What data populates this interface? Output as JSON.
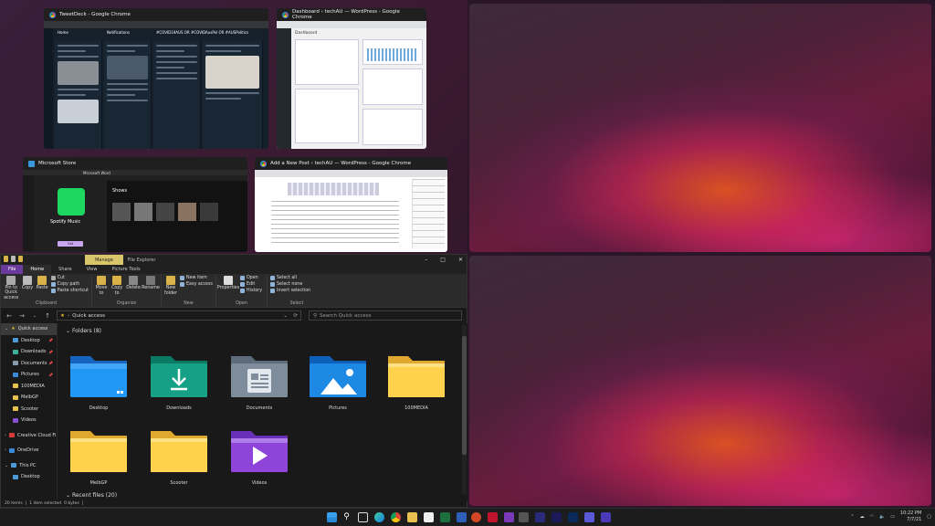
{
  "thumbnails": {
    "tweetdeck": {
      "title": "TweetDeck - Google Chrome",
      "columns": [
        "Home",
        "Notifications",
        "#COVID19AUS OR #COVID",
        "AusPol OR #AUSPolitics"
      ]
    },
    "dashboard": {
      "title": "Dashboard ‹ techAU — WordPress - Google Chrome",
      "heading": "Dashboard"
    },
    "store": {
      "title": "Microsoft Store",
      "tab2": "Microsoft Word",
      "app_name": "Spotify Music",
      "get_label": "Get",
      "shows_label": "Shows"
    },
    "newpost": {
      "title": "Add a New Post ‹ techAU — WordPress - Google Chrome"
    }
  },
  "explorer": {
    "title": "File Explorer",
    "manage_tab": "Manage",
    "window_controls": [
      "–",
      "□",
      "✕"
    ],
    "ribbon_tabs": [
      "File",
      "Home",
      "Share",
      "View",
      "Picture Tools"
    ],
    "ribbon": {
      "clipboard": {
        "label": "Clipboard",
        "pin": "Pin to Quick access",
        "copy": "Copy",
        "paste": "Paste",
        "cut": "Cut",
        "copy_path": "Copy path",
        "paste_shortcut": "Paste shortcut"
      },
      "organize": {
        "label": "Organize",
        "move_to": "Move to",
        "copy_to": "Copy to",
        "delete": "Delete",
        "rename": "Rename"
      },
      "new": {
        "label": "New",
        "new_folder": "New folder",
        "new_item": "New item",
        "easy_access": "Easy access"
      },
      "open": {
        "label": "Open",
        "properties": "Properties",
        "open": "Open",
        "edit": "Edit",
        "history": "History"
      },
      "select": {
        "label": "Select",
        "select_all": "Select all",
        "select_none": "Select none",
        "invert": "Invert selection"
      }
    },
    "address": "Quick access",
    "search_placeholder": "Search Quick access",
    "nav": [
      {
        "label": "Quick access",
        "level": 0,
        "selected": true
      },
      {
        "label": "Desktop",
        "level": 1,
        "pinned": true
      },
      {
        "label": "Downloads",
        "level": 1,
        "pinned": true
      },
      {
        "label": "Documents",
        "level": 1,
        "pinned": true
      },
      {
        "label": "Pictures",
        "level": 1,
        "pinned": true
      },
      {
        "label": "100MEDIA",
        "level": 1
      },
      {
        "label": "MelbGP",
        "level": 1
      },
      {
        "label": "Scooter",
        "level": 1
      },
      {
        "label": "Videos",
        "level": 1
      },
      {
        "label": "Creative Cloud Fi",
        "level": 0
      },
      {
        "label": "OneDrive",
        "level": 0
      },
      {
        "label": "This PC",
        "level": 0
      },
      {
        "label": "Desktop",
        "level": 1
      }
    ],
    "folders_heading": "Folders (8)",
    "folders": [
      "Desktop",
      "Downloads",
      "Documents",
      "Pictures",
      "100MEDIA",
      "MelbGP",
      "Scooter",
      "Videos"
    ],
    "recent_heading": "Recent files (20)",
    "status": {
      "items": "20 items",
      "selected": "1 item selected",
      "size": "0 bytes"
    }
  },
  "taskbar": {
    "time": "10:22 PM",
    "date": "7/7/21",
    "colors": {
      "bg": "#1c1c1c"
    }
  }
}
